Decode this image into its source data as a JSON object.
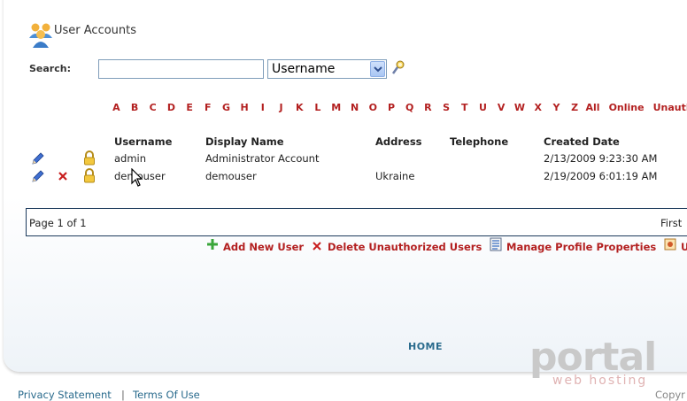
{
  "header": {
    "title": "User Accounts",
    "icon": "users-icon"
  },
  "search": {
    "label": "Search:",
    "value": "",
    "placeholder": "",
    "field_selected": "Username",
    "go_icon": "search-icon"
  },
  "alphabet": [
    "A",
    "B",
    "C",
    "D",
    "E",
    "F",
    "G",
    "H",
    "I",
    "J",
    "K",
    "L",
    "M",
    "N",
    "O",
    "P",
    "Q",
    "R",
    "S",
    "T",
    "U",
    "V",
    "W",
    "X",
    "Y",
    "Z",
    "All",
    "Online",
    "Unauth"
  ],
  "table": {
    "columns": [
      "Username",
      "Display Name",
      "Address",
      "Telephone",
      "Created Date"
    ],
    "rows": [
      {
        "username": "admin",
        "display_name": "Administrator Account",
        "address": "",
        "telephone": "",
        "created": "2/13/2009 9:23:30 AM",
        "deletable": false
      },
      {
        "username": "demouser",
        "display_name": "demouser",
        "address": "Ukraine",
        "telephone": "",
        "created": "2/19/2009 6:01:19 AM",
        "deletable": true
      }
    ]
  },
  "pager": {
    "info": "Page 1 of 1",
    "first": "First"
  },
  "actions": {
    "add": "Add New User",
    "delete_unauthorized": "Delete Unauthorized Users",
    "manage_profile": "Manage Profile Properties",
    "extra": "U"
  },
  "nav": {
    "home": "HOME"
  },
  "logo": {
    "main": "portal",
    "sub": "web hosting"
  },
  "footer": {
    "privacy": "Privacy Statement",
    "sep": "|",
    "terms": "Terms Of Use",
    "copyright": "Copyr"
  },
  "colors": {
    "accent_red": "#b32020",
    "link_blue": "#2a6b8d",
    "border_navy": "#1c3a5c"
  }
}
